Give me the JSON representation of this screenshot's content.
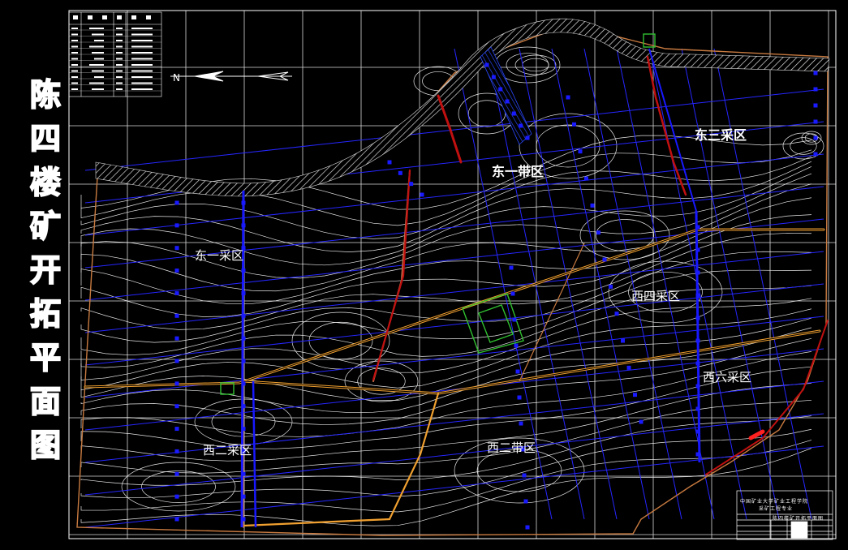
{
  "drawing": {
    "title_chars": [
      "陈",
      "四",
      "楼",
      "矿",
      "开",
      "拓",
      "平",
      "面",
      "图"
    ],
    "zones": {
      "east_one_belt": "东一带区",
      "east_three_mining": "东三采区",
      "east_one_mining": "东一采区",
      "west_four_mining": "西四采区",
      "west_six_mining": "西六采区",
      "west_two_mining": "西二采区",
      "west_two_belt": "西二带区"
    },
    "title_block": {
      "line1": "中国矿业大学矿业工程学院",
      "line2": "采矿工程专业",
      "drawing_name": "陈四楼矿开拓平面图"
    }
  },
  "colors": {
    "background": "#000000",
    "grid": "#ffffff",
    "contours": "#ffffff",
    "drift_blue": "#1818ff",
    "roadway_orange": "#f0a030",
    "fault_red": "#d01010",
    "boundary_brown": "#c87a40",
    "pit_green": "#30c030"
  }
}
